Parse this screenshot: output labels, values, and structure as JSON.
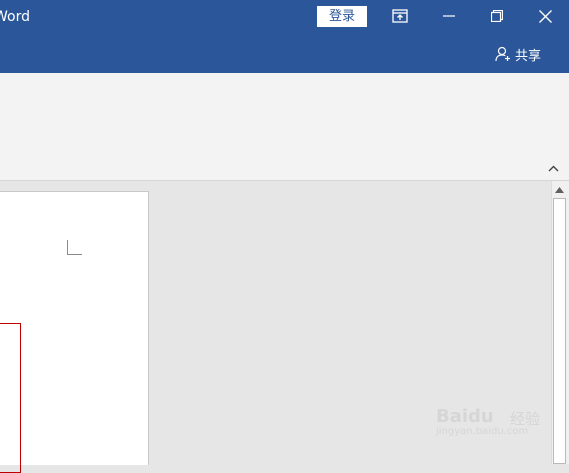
{
  "titlebar": {
    "app_title": "Word",
    "login_label": "登录",
    "share_label": "共享",
    "background_color": "#2b579a"
  },
  "window_controls": {
    "ribbon_display_icon": "ribbon-display-options-icon",
    "minimize_icon": "minimize-icon",
    "restore_icon": "restore-icon",
    "close_icon": "close-icon"
  },
  "ribbon": {
    "collapse_icon": "chevron-up-icon"
  },
  "scrollbar": {
    "up_icon": "scroll-up-arrow-icon"
  },
  "watermark": {
    "brand": "Baidu",
    "sub": "经验",
    "url": "jingyan.baidu.com"
  }
}
